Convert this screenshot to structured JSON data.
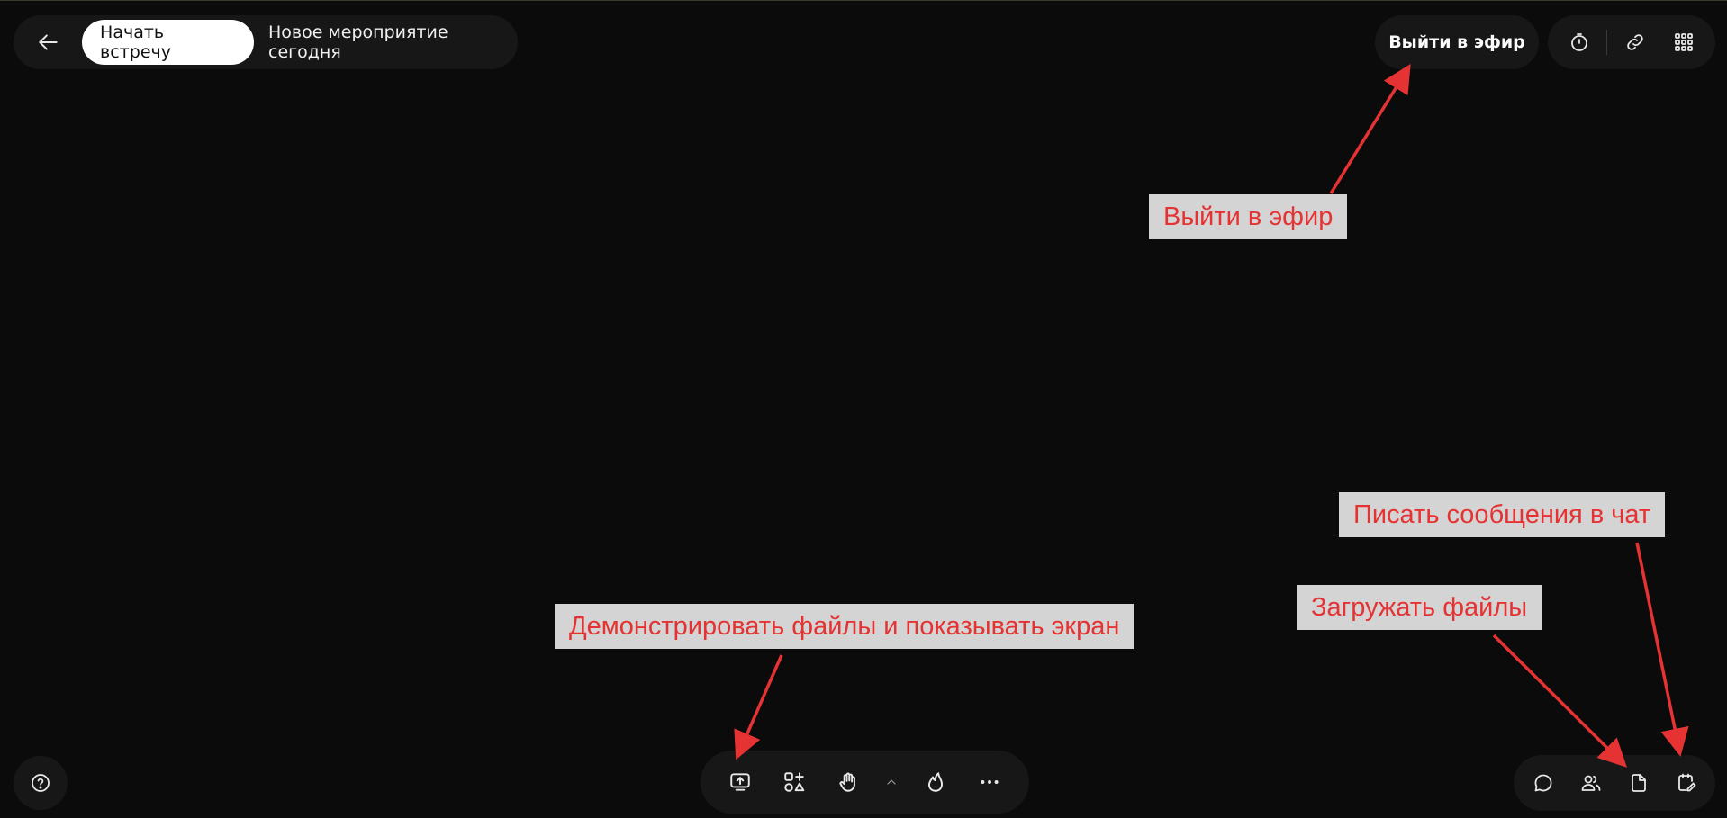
{
  "header": {
    "back_icon": "arrow-left-icon",
    "start_meeting_label": "Начать встречу",
    "event_title": "Новое мероприятие сегодня",
    "go_live_label": "Выйти в эфир",
    "tools": [
      {
        "icon": "timer-icon"
      },
      {
        "icon": "link-icon"
      },
      {
        "icon": "apps-grid-icon"
      }
    ]
  },
  "bottom_bar": {
    "help_icon": "question-circle-icon",
    "center_tools": [
      {
        "icon": "screen-share-icon"
      },
      {
        "icon": "add-apps-icon"
      },
      {
        "icon": "raise-hand-icon"
      },
      {
        "icon": "chevron-up-icon"
      },
      {
        "icon": "reaction-flame-icon"
      },
      {
        "icon": "more-dots-icon"
      }
    ],
    "right_tools": [
      {
        "icon": "chat-bubble-icon"
      },
      {
        "icon": "participants-icon"
      },
      {
        "icon": "file-icon"
      },
      {
        "icon": "notes-edit-icon"
      }
    ]
  },
  "annotations": {
    "go_live": "Выйти в эфир",
    "chat": "Писать сообщения в чат",
    "upload_files": "Загружать файлы",
    "screen_share": "Демонстрировать файлы и показывать экран"
  },
  "colors": {
    "background": "#0b0b0b",
    "panel": "#171717",
    "annotation_bg": "#d4d4d4",
    "annotation_text": "#e53333",
    "arrow": "#e53333"
  }
}
